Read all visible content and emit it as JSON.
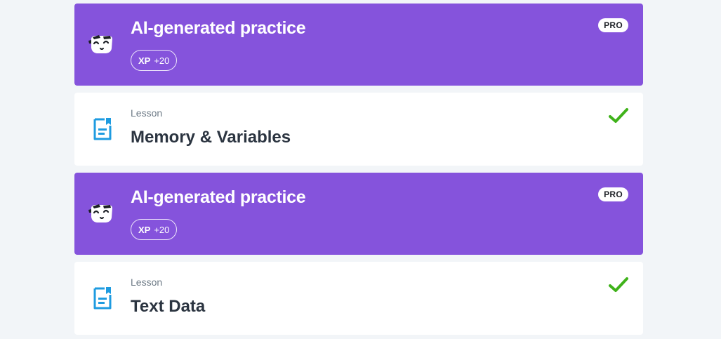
{
  "items": [
    {
      "kind": "ai_practice",
      "title": "AI-generated practice",
      "xp_label": "XP",
      "xp_value": "+20",
      "badge": "PRO",
      "icon": "ai-mascot-icon"
    },
    {
      "kind": "lesson",
      "kicker": "Lesson",
      "title": "Memory & Variables",
      "completed": true,
      "icon": "lesson-document-icon",
      "status_icon": "checkmark-icon"
    },
    {
      "kind": "ai_practice",
      "title": "AI-generated practice",
      "xp_label": "XP",
      "xp_value": "+20",
      "badge": "PRO",
      "icon": "ai-mascot-icon"
    },
    {
      "kind": "lesson",
      "kicker": "Lesson",
      "title": "Text Data",
      "completed": true,
      "icon": "lesson-document-icon",
      "status_icon": "checkmark-icon"
    }
  ],
  "colors": {
    "ai_card": "#8553dc",
    "lesson_card": "#ffffff",
    "page_bg": "#f2f5f8",
    "check": "#3fb21a",
    "lesson_icon": "#1e9be0"
  }
}
